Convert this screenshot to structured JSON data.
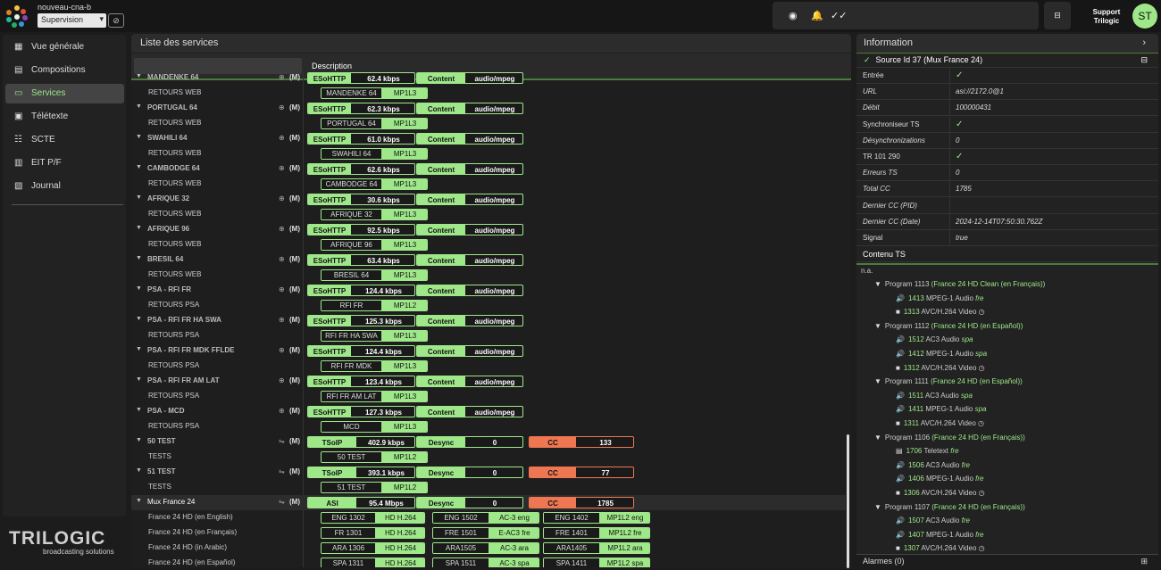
{
  "header": {
    "site": "nouveau-cna-b",
    "mode": "Supervision",
    "user_line1": "Support",
    "user_line2": "Trilogic",
    "avatar": "ST",
    "icons": [
      "headset-alert-icon",
      "bell-icon",
      "double-check-icon",
      "network-icon",
      "visibility-off-icon"
    ]
  },
  "nav": {
    "items": [
      {
        "label": "Vue générale",
        "icon": "grid-icon"
      },
      {
        "label": "Compositions",
        "icon": "layout-icon"
      },
      {
        "label": "Services",
        "icon": "monitor-icon",
        "active": true
      },
      {
        "label": "Télétexte",
        "icon": "teletext-icon"
      },
      {
        "label": "SCTE",
        "icon": "scte-icon"
      },
      {
        "label": "EIT P/F",
        "icon": "calendar-icon"
      },
      {
        "label": "Journal",
        "icon": "journal-icon"
      }
    ]
  },
  "brand": {
    "name": "TRILOGIC",
    "tagline": "broadcasting solutions"
  },
  "services": {
    "title": "Liste des services",
    "col": "Description",
    "rows": [
      {
        "name": "MANDENKE 64",
        "sub": "RETOURS WEB",
        "proto": "ESoHTTP",
        "rate": "62.4 kbps",
        "ct": "Content",
        "fmt": "audio/mpeg",
        "tag": "MANDENKE 64",
        "codec": "MP1L3"
      },
      {
        "name": "PORTUGAL 64",
        "sub": "RETOURS WEB",
        "proto": "ESoHTTP",
        "rate": "62.3 kbps",
        "ct": "Content",
        "fmt": "audio/mpeg",
        "tag": "PORTUGAL 64",
        "codec": "MP1L3"
      },
      {
        "name": "SWAHILI 64",
        "sub": "RETOURS WEB",
        "proto": "ESoHTTP",
        "rate": "61.0 kbps",
        "ct": "Content",
        "fmt": "audio/mpeg",
        "tag": "SWAHILI 64",
        "codec": "MP1L3"
      },
      {
        "name": "CAMBODGE 64",
        "sub": "RETOURS WEB",
        "proto": "ESoHTTP",
        "rate": "62.6 kbps",
        "ct": "Content",
        "fmt": "audio/mpeg",
        "tag": "CAMBODGE 64",
        "codec": "MP1L3"
      },
      {
        "name": "AFRIQUE 32",
        "sub": "RETOURS WEB",
        "proto": "ESoHTTP",
        "rate": "30.6 kbps",
        "ct": "Content",
        "fmt": "audio/mpeg",
        "tag": "AFRIQUE 32",
        "codec": "MP1L3"
      },
      {
        "name": "AFRIQUE 96",
        "sub": "RETOURS WEB",
        "proto": "ESoHTTP",
        "rate": "92.5 kbps",
        "ct": "Content",
        "fmt": "audio/mpeg",
        "tag": "AFRIQUE 96",
        "codec": "MP1L3"
      },
      {
        "name": "BRESIL 64",
        "sub": "RETOURS WEB",
        "proto": "ESoHTTP",
        "rate": "63.4 kbps",
        "ct": "Content",
        "fmt": "audio/mpeg",
        "tag": "BRESIL 64",
        "codec": "MP1L3"
      },
      {
        "name": "PSA - RFI FR",
        "sub": "RETOURS PSA",
        "proto": "ESoHTTP",
        "rate": "124.4 kbps",
        "ct": "Content",
        "fmt": "audio/mpeg",
        "tag": "RFI FR",
        "codec": "MP1L2"
      },
      {
        "name": "PSA - RFI FR HA SWA",
        "sub": "RETOURS PSA",
        "proto": "ESoHTTP",
        "rate": "125.3 kbps",
        "ct": "Content",
        "fmt": "audio/mpeg",
        "tag": "RFI FR HA SWA",
        "codec": "MP1L3"
      },
      {
        "name": "PSA - RFI FR MDK FFLDE",
        "sub": "RETOURS PSA",
        "proto": "ESoHTTP",
        "rate": "124.4 kbps",
        "ct": "Content",
        "fmt": "audio/mpeg",
        "tag": "RFI FR MDK FFLDE",
        "codec": "MP1L3"
      },
      {
        "name": "PSA - RFI FR AM LAT",
        "sub": "RETOURS PSA",
        "proto": "ESoHTTP",
        "rate": "123.4 kbps",
        "ct": "Content",
        "fmt": "audio/mpeg",
        "tag": "RFI FR AM LAT",
        "codec": "MP1L3"
      },
      {
        "name": "PSA - MCD",
        "sub": "RETOURS PSA",
        "proto": "ESoHTTP",
        "rate": "127.3 kbps",
        "ct": "Content",
        "fmt": "audio/mpeg",
        "tag": "MCD",
        "codec": "MP1L3"
      },
      {
        "name": "50 TEST",
        "sub": "TESTS",
        "proto": "TSoIP",
        "rate": "402.9 kbps",
        "ct": "Desync",
        "fmt": "0",
        "cc": "CC",
        "ccv": "133",
        "tag": "50 TEST",
        "codec": "MP1L2"
      },
      {
        "name": "51 TEST",
        "sub": "TESTS",
        "proto": "TSoIP",
        "rate": "393.1 kbps",
        "ct": "Desync",
        "fmt": "0",
        "cc": "CC",
        "ccv": "77",
        "tag": "51 TEST",
        "codec": "MP1L2"
      }
    ],
    "mux": {
      "name": "Mux France 24",
      "proto": "ASI",
      "rate": "95.4 Mbps",
      "ct": "Desync",
      "fmt": "0",
      "cc": "CC",
      "ccv": "1785",
      "subs": [
        {
          "name": "France 24 HD (en English)",
          "t": [
            [
              "ENG 1302",
              "HD H.264"
            ],
            [
              "ENG 1502",
              "AC-3 eng"
            ],
            [
              "ENG 1402",
              "MP1L2 eng"
            ]
          ]
        },
        {
          "name": "France 24 HD (en Français)",
          "t": [
            [
              "FR 1301",
              "HD H.264"
            ],
            [
              "FRE 1501",
              "E-AC3 fre"
            ],
            [
              "FRE 1401",
              "MP1L2 fre"
            ]
          ]
        },
        {
          "name": "France 24 HD (in Arabic)",
          "t": [
            [
              "ARA 1306",
              "HD H.264"
            ],
            [
              "ARA1505",
              "AC-3 ara"
            ],
            [
              "ARA1405",
              "MP1L2 ara"
            ]
          ]
        },
        {
          "name": "France 24 HD (en Español)",
          "t": [
            [
              "SPA 1311",
              "HD H.264"
            ],
            [
              "SPA 1511",
              "AC-3 spa"
            ],
            [
              "SPA 1411",
              "MP1L2 spa"
            ]
          ]
        }
      ]
    }
  },
  "info": {
    "title": "Information",
    "source": "Source Id 37 (Mux France 24)",
    "fields": [
      {
        "k": "Entrée",
        "v": "✓",
        "check": true
      },
      {
        "k": "URL",
        "v": "asi://2172.0@1",
        "kit": true
      },
      {
        "k": "Débit",
        "v": "100000431",
        "kit": true
      },
      {
        "k": "Synchroniseur TS",
        "v": "✓",
        "check": true
      },
      {
        "k": "Désynchronizations",
        "v": "0",
        "kit": true
      },
      {
        "k": "TR 101 290",
        "v": "✓",
        "check": true
      },
      {
        "k": "Erreurs TS",
        "v": "0",
        "kit": true
      },
      {
        "k": "Total CC",
        "v": "1785",
        "kit": true
      },
      {
        "k": "Dernier CC (PID)",
        "v": "",
        "kit": true
      },
      {
        "k": "Dernier CC (Date)",
        "v": "2024-12-14T07:50:30.762Z",
        "kit": true
      },
      {
        "k": "Signal",
        "v": "true",
        "kit": true
      }
    ],
    "ts_title": "Contenu TS",
    "na": "n.a.",
    "tree": [
      {
        "p": "Program 1113",
        "d": "(France 24 HD Clean (en Français))",
        "c": [
          {
            "ic": "🔊",
            "id": "1413",
            "t": "MPEG-1 Audio",
            "l": "fre"
          },
          {
            "ic": "■",
            "id": "1313",
            "t": "AVC/H.264 Video",
            "l": "◷"
          }
        ]
      },
      {
        "p": "Program 1112",
        "d": "(France 24 HD (en Español))",
        "c": [
          {
            "ic": "🔊",
            "id": "1512",
            "t": "AC3 Audio",
            "l": "spa"
          },
          {
            "ic": "🔊",
            "id": "1412",
            "t": "MPEG-1 Audio",
            "l": "spa"
          },
          {
            "ic": "■",
            "id": "1312",
            "t": "AVC/H.264 Video",
            "l": "◷"
          }
        ]
      },
      {
        "p": "Program 1111",
        "d": "(France 24 HD (en Español))",
        "c": [
          {
            "ic": "🔊",
            "id": "1511",
            "t": "AC3 Audio",
            "l": "spa"
          },
          {
            "ic": "🔊",
            "id": "1411",
            "t": "MPEG-1 Audio",
            "l": "spa"
          },
          {
            "ic": "■",
            "id": "1311",
            "t": "AVC/H.264 Video",
            "l": "◷"
          }
        ]
      },
      {
        "p": "Program 1106",
        "d": "(France 24 HD (en Français))",
        "c": [
          {
            "ic": "▤",
            "id": "1706",
            "t": "Teletext",
            "l": "fre"
          },
          {
            "ic": "🔊",
            "id": "1506",
            "t": "AC3 Audio",
            "l": "fre"
          },
          {
            "ic": "🔊",
            "id": "1406",
            "t": "MPEG-1 Audio",
            "l": "fre"
          },
          {
            "ic": "■",
            "id": "1306",
            "t": "AVC/H.264 Video",
            "l": "◷"
          }
        ]
      },
      {
        "p": "Program 1107",
        "d": "(France 24 HD (en Français))",
        "c": [
          {
            "ic": "🔊",
            "id": "1507",
            "t": "AC3 Audio",
            "l": "fre"
          },
          {
            "ic": "🔊",
            "id": "1407",
            "t": "MPEG-1 Audio",
            "l": "fre"
          },
          {
            "ic": "■",
            "id": "1307",
            "t": "AVC/H.264 Video",
            "l": "◷"
          }
        ]
      }
    ],
    "alarms": "Alarmes (0)"
  },
  "colors": {
    "accent": "#9fe88a",
    "alert": "#ee7752",
    "bg": "#1c1c1c"
  }
}
